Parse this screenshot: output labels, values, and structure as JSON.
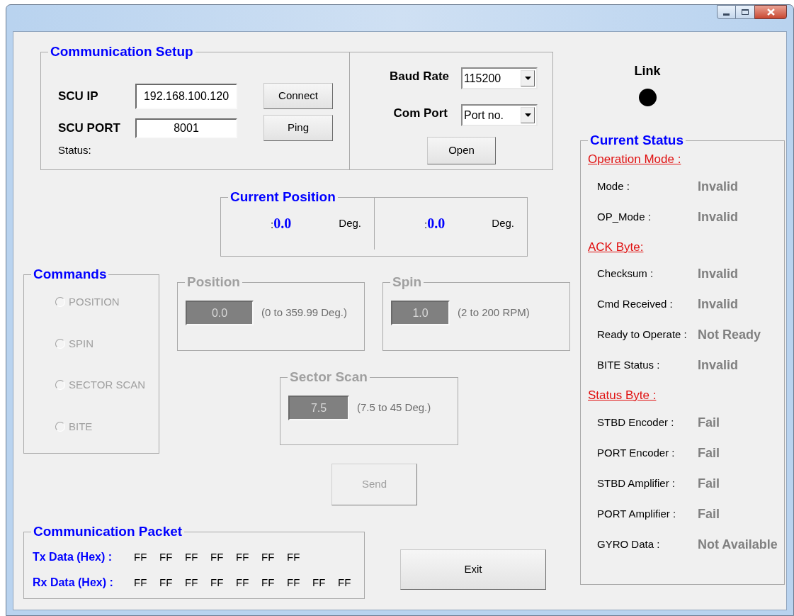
{
  "communication_setup": {
    "title": "Communication Setup",
    "ip_label": "SCU IP",
    "ip_value": "192.168.100.120",
    "port_label": "SCU PORT",
    "port_value": "8001",
    "connect_button": "Connect",
    "ping_button": "Ping",
    "status_label": "Status:",
    "baud_rate_label": "Baud Rate",
    "baud_rate_value": "115200",
    "com_port_label": "Com Port",
    "com_port_value": "Port no.",
    "open_button": "Open"
  },
  "link": {
    "label": "Link",
    "on": false
  },
  "current_position": {
    "title": "Current Position",
    "readings": [
      {
        "prefix": ":",
        "value": "0.0",
        "unit": "Deg."
      },
      {
        "prefix": ":",
        "value": "0.0",
        "unit": "Deg."
      }
    ]
  },
  "commands": {
    "title": "Commands",
    "disabled": true,
    "options": [
      {
        "label": "POSITION",
        "selected": false
      },
      {
        "label": "SPIN",
        "selected": false
      },
      {
        "label": "SECTOR SCAN",
        "selected": false
      },
      {
        "label": "BITE",
        "selected": false
      }
    ]
  },
  "position": {
    "title": "Position",
    "disabled": true,
    "value": "0.0",
    "range": "(0 to 359.99 Deg.)"
  },
  "spin": {
    "title": "Spin",
    "disabled": true,
    "value": "1.0",
    "range": "(2 to 200 RPM)"
  },
  "sector_scan": {
    "title": "Sector Scan",
    "disabled": true,
    "value": "7.5",
    "range": "(7.5 to 45 Deg.)"
  },
  "send_button": {
    "label": "Send",
    "disabled": true
  },
  "communication_packet": {
    "title": "Communication Packet",
    "rows": [
      {
        "label": "Tx Data (Hex) :",
        "bytes": [
          "FF",
          "FF",
          "FF",
          "FF",
          "FF",
          "FF",
          "FF"
        ]
      },
      {
        "label": "Rx Data (Hex) :",
        "bytes": [
          "FF",
          "FF",
          "FF",
          "FF",
          "FF",
          "FF",
          "FF",
          "FF",
          "FF"
        ]
      }
    ]
  },
  "exit_button": {
    "label": "Exit"
  },
  "current_status": {
    "title": "Current Status",
    "sections": [
      {
        "heading": "Operation Mode :",
        "items": [
          {
            "label": "Mode :",
            "value": "Invalid"
          },
          {
            "label": "OP_Mode :",
            "value": "Invalid"
          }
        ]
      },
      {
        "heading": "ACK Byte:",
        "items": [
          {
            "label": "Checksum :",
            "value": "Invalid"
          },
          {
            "label": "Cmd Received :",
            "value": "Invalid"
          },
          {
            "label": "Ready to Operate :",
            "value": "Not Ready"
          },
          {
            "label": "BITE Status :",
            "value": "Invalid"
          }
        ]
      },
      {
        "heading": "Status Byte :",
        "items": [
          {
            "label": "STBD Encoder :",
            "value": "Fail"
          },
          {
            "label": "PORT Encoder :",
            "value": "Fail"
          },
          {
            "label": "STBD Amplifier :",
            "value": "Fail"
          },
          {
            "label": "PORT Amplifier :",
            "value": "Fail"
          },
          {
            "label": "GYRO Data :",
            "value": "Not Available"
          }
        ]
      }
    ]
  }
}
